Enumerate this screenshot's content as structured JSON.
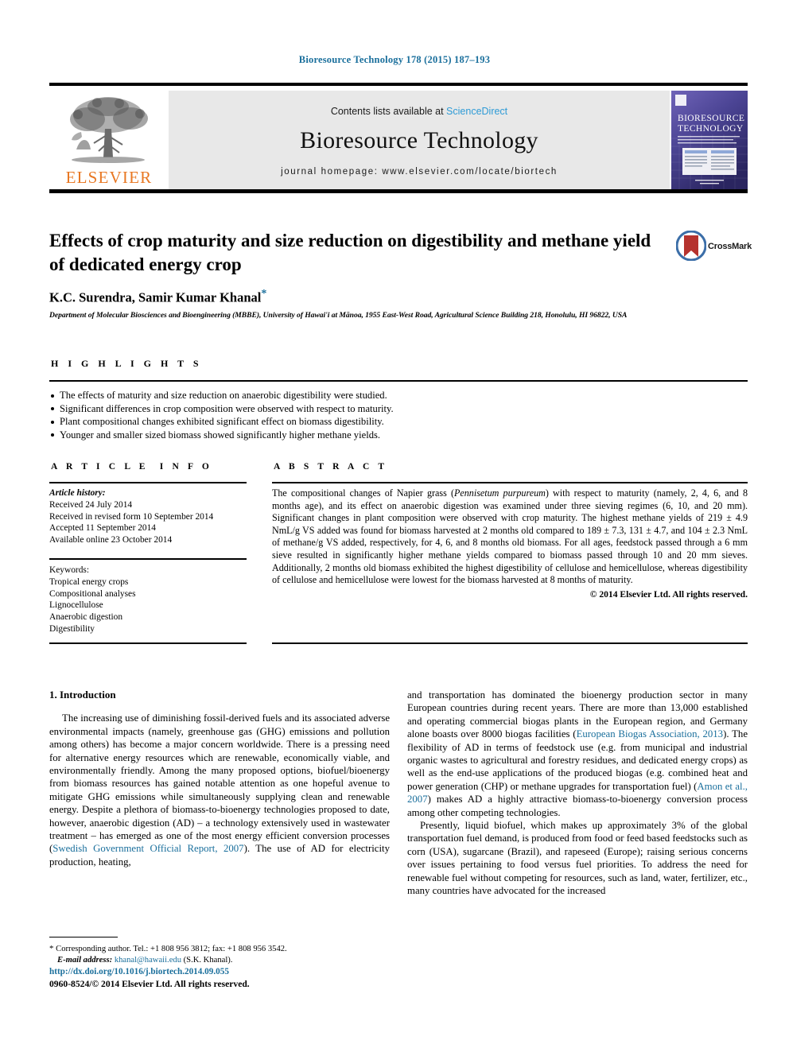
{
  "running_head": "Bioresource Technology 178 (2015) 187–193",
  "masthead": {
    "publisher_name": "ELSEVIER",
    "contents_prefix": "Contents lists available at ",
    "sciencedirect": "ScienceDirect",
    "journal_title": "Bioresource Technology",
    "journal_homepage": "journal homepage: www.elsevier.com/locate/biortech",
    "cover": {
      "line1": "BIORESOURCE",
      "line2": "TECHNOLOGY"
    }
  },
  "article": {
    "title": "Effects of crop maturity and size reduction on digestibility and methane yield of dedicated energy crop",
    "authors": "K.C. Surendra, Samir Kumar Khanal",
    "author_marker": "*",
    "affiliation": "Department of Molecular Biosciences and Bioengineering (MBBE), University of Hawai'i at Mānoa, 1955 East-West Road, Agricultural Science Building 218, Honolulu, HI 96822, USA",
    "crossmark_label": "CrossMark"
  },
  "highlights": {
    "heading": "HIGHLIGHTS",
    "items": [
      "The effects of maturity and size reduction on anaerobic digestibility were studied.",
      "Significant differences in crop composition were observed with respect to maturity.",
      "Plant compositional changes exhibited significant effect on biomass digestibility.",
      "Younger and smaller sized biomass showed significantly higher methane yields."
    ]
  },
  "article_info": {
    "heading": "ARTICLE INFO",
    "history_label": "Article history:",
    "history": [
      "Received 24 July 2014",
      "Received in revised form 10 September 2014",
      "Accepted 11 September 2014",
      "Available online 23 October 2014"
    ],
    "keywords_label": "Keywords:",
    "keywords": [
      "Tropical energy crops",
      "Compositional analyses",
      "Lignocellulose",
      "Anaerobic digestion",
      "Digestibility"
    ]
  },
  "abstract": {
    "heading": "ABSTRACT",
    "part1": "The compositional changes of Napier grass (",
    "species": "Pennisetum purpureum",
    "part2": ") with respect to maturity (namely, 2, 4, 6, and 8 months age), and its effect on anaerobic digestion was examined under three sieving regimes (6, 10, and 20 mm). Significant changes in plant composition were observed with crop maturity. The highest methane yields of 219 ± 4.9 NmL/g VS added was found for biomass harvested at 2 months old compared to 189 ± 7.3, 131 ± 4.7, and 104 ± 2.3 NmL of methane/g VS added, respectively, for 4, 6, and 8 months old biomass. For all ages, feedstock passed through a 6 mm sieve resulted in significantly higher methane yields compared to biomass passed through 10 and 20 mm sieves. Additionally, 2 months old biomass exhibited the highest digestibility of cellulose and hemicellulose, whereas digestibility of cellulose and hemicellulose were lowest for the biomass harvested at 8 months of maturity.",
    "copyright": "© 2014 Elsevier Ltd. All rights reserved."
  },
  "body": {
    "section_heading": "1. Introduction",
    "left_para1_a": "The increasing use of diminishing fossil-derived fuels and its associated adverse environmental impacts (namely, greenhouse gas (GHG) emissions and pollution among others) has become a major concern worldwide. There is a pressing need for alternative energy resources which are renewable, economically viable, and environmentally friendly. Among the many proposed options, biofuel/bioenergy from biomass resources has gained notable attention as one hopeful avenue to mitigate GHG emissions while simultaneously supplying clean and renewable energy. Despite a plethora of biomass-to-bioenergy technologies proposed to date, however, anaerobic digestion (AD) – a technology extensively used in wastewater treatment – has emerged as one of the most energy efficient conversion processes (",
    "left_cite1": "Swedish Government Official Report, 2007",
    "left_para1_b": "). The use of AD for electricity production, heating,",
    "right_para1_a": "and transportation has dominated the bioenergy production sector in many European countries during recent years. There are more than 13,000 established and operating commercial biogas plants in the European region, and Germany alone boasts over 8000 biogas facilities (",
    "right_cite1": "European Biogas Association, 2013",
    "right_para1_b": "). The flexibility of AD in terms of feedstock use (e.g. from municipal and industrial organic wastes to agricultural and forestry residues, and dedicated energy crops) as well as the end-use applications of the produced biogas (e.g. combined heat and power generation (CHP) or methane upgrades for transportation fuel) (",
    "right_cite2": "Amon et al., 2007",
    "right_para1_c": ") makes AD a highly attractive biomass-to-bioenergy conversion process among other competing technologies.",
    "right_para2": "Presently, liquid biofuel, which makes up approximately 3% of the global transportation fuel demand, is produced from food or feed based feedstocks such as corn (USA), sugarcane (Brazil), and rapeseed (Europe); raising serious concerns over issues pertaining to food versus fuel priorities. To address the need for renewable fuel without competing for resources, such as land, water, fertilizer, etc., many countries have advocated for the increased"
  },
  "footnote": {
    "marker": "*",
    "corresponding": "Corresponding author. Tel.: +1 808 956 3812; fax: +1 808 956 3542.",
    "email_label": "E-mail address:",
    "email": "khanal@hawaii.edu",
    "email_owner": "(S.K. Khanal)."
  },
  "footer": {
    "doi": "http://dx.doi.org/10.1016/j.biortech.2014.09.055",
    "issn": "0960-8524/© 2014 Elsevier Ltd. All rights reserved."
  },
  "colors": {
    "link": "#1a6f9c",
    "sciencedirect": "#2E9BD6",
    "elsevier_orange": "#E87722",
    "band_gray": "#e8e8e8"
  }
}
